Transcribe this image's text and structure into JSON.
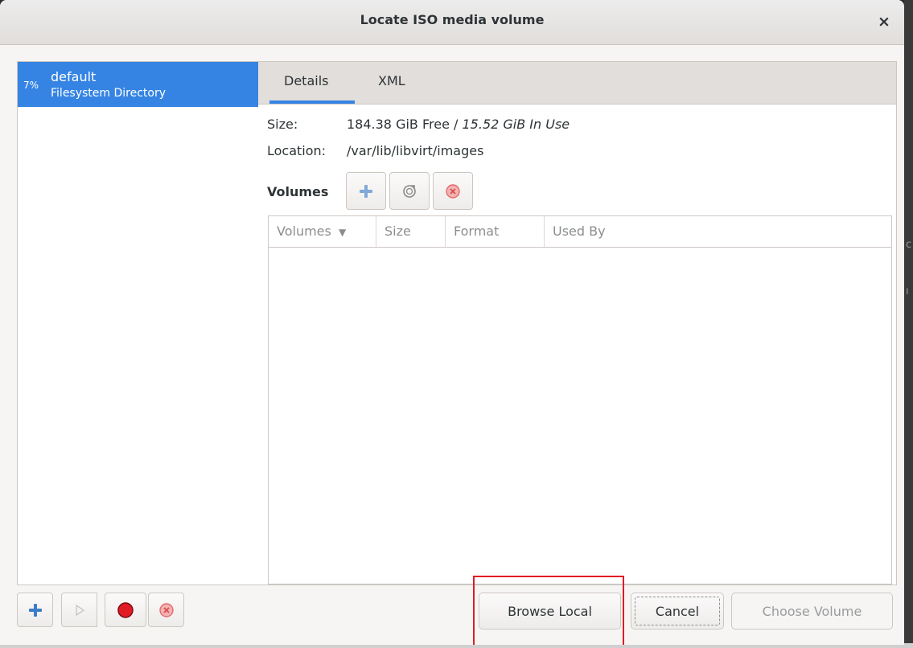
{
  "window": {
    "title": "Locate ISO media volume"
  },
  "pools": [
    {
      "percent": "7%",
      "name": "default",
      "type": "Filesystem Directory",
      "selected": true
    }
  ],
  "tabs": [
    {
      "label": "Details",
      "active": true
    },
    {
      "label": "XML",
      "active": false
    }
  ],
  "details": {
    "size_label": "Size:",
    "size_free": "184.38 GiB Free",
    "size_sep": " / ",
    "size_used": "15.52 GiB In Use",
    "location_label": "Location:",
    "location_value": "/var/lib/libvirt/images"
  },
  "volumes": {
    "label": "Volumes",
    "toolbar_icons": [
      "add-icon",
      "refresh-icon",
      "delete-icon"
    ],
    "columns": [
      "Volumes",
      "Size",
      "Format",
      "Used By"
    ],
    "sort_indicator": "▼",
    "rows": []
  },
  "pool_toolbar_icons": [
    "add-pool-icon",
    "start-pool-icon",
    "stop-pool-icon",
    "delete-pool-icon"
  ],
  "buttons": {
    "browse_local": "Browse Local",
    "cancel": "Cancel",
    "choose_volume": "Choose Volume"
  },
  "colors": {
    "accent": "#3584e4",
    "highlight": "#e01b24"
  }
}
